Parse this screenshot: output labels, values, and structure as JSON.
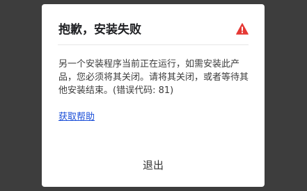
{
  "dialog": {
    "title": "抱歉，安装失败",
    "icon": "warning-triangle-icon",
    "icon_color": "#e53935",
    "message": "另一个安装程序当前正在运行，如需安装此产品，您必须将其关闭。请将其关闭，或者等待其他安装结束。(错误代码: 81)",
    "help_link": "获取帮助",
    "exit_button": "退出"
  }
}
